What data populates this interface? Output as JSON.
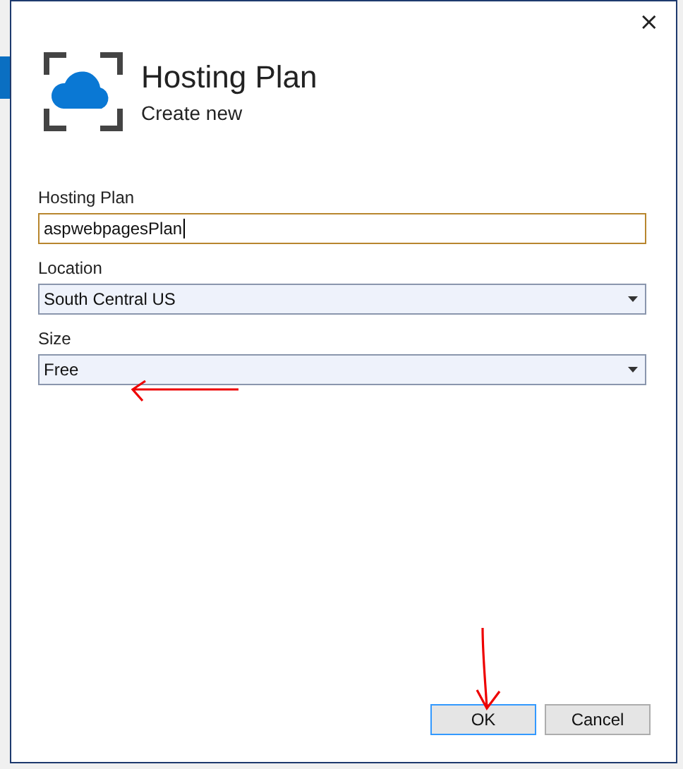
{
  "dialog": {
    "title": "Hosting Plan",
    "subtitle": "Create new"
  },
  "fields": [
    {
      "kind": "text",
      "label": "Hosting Plan",
      "value": "aspwebpagesPlan",
      "focused": true
    },
    {
      "kind": "dropdown",
      "label": "Location",
      "value": "South Central US",
      "focused": false
    },
    {
      "kind": "dropdown",
      "label": "Size",
      "value": "Free",
      "focused": false
    }
  ],
  "buttons": [
    {
      "label": "OK",
      "default": true
    },
    {
      "label": "Cancel",
      "default": false
    }
  ],
  "close_glyph": "×"
}
